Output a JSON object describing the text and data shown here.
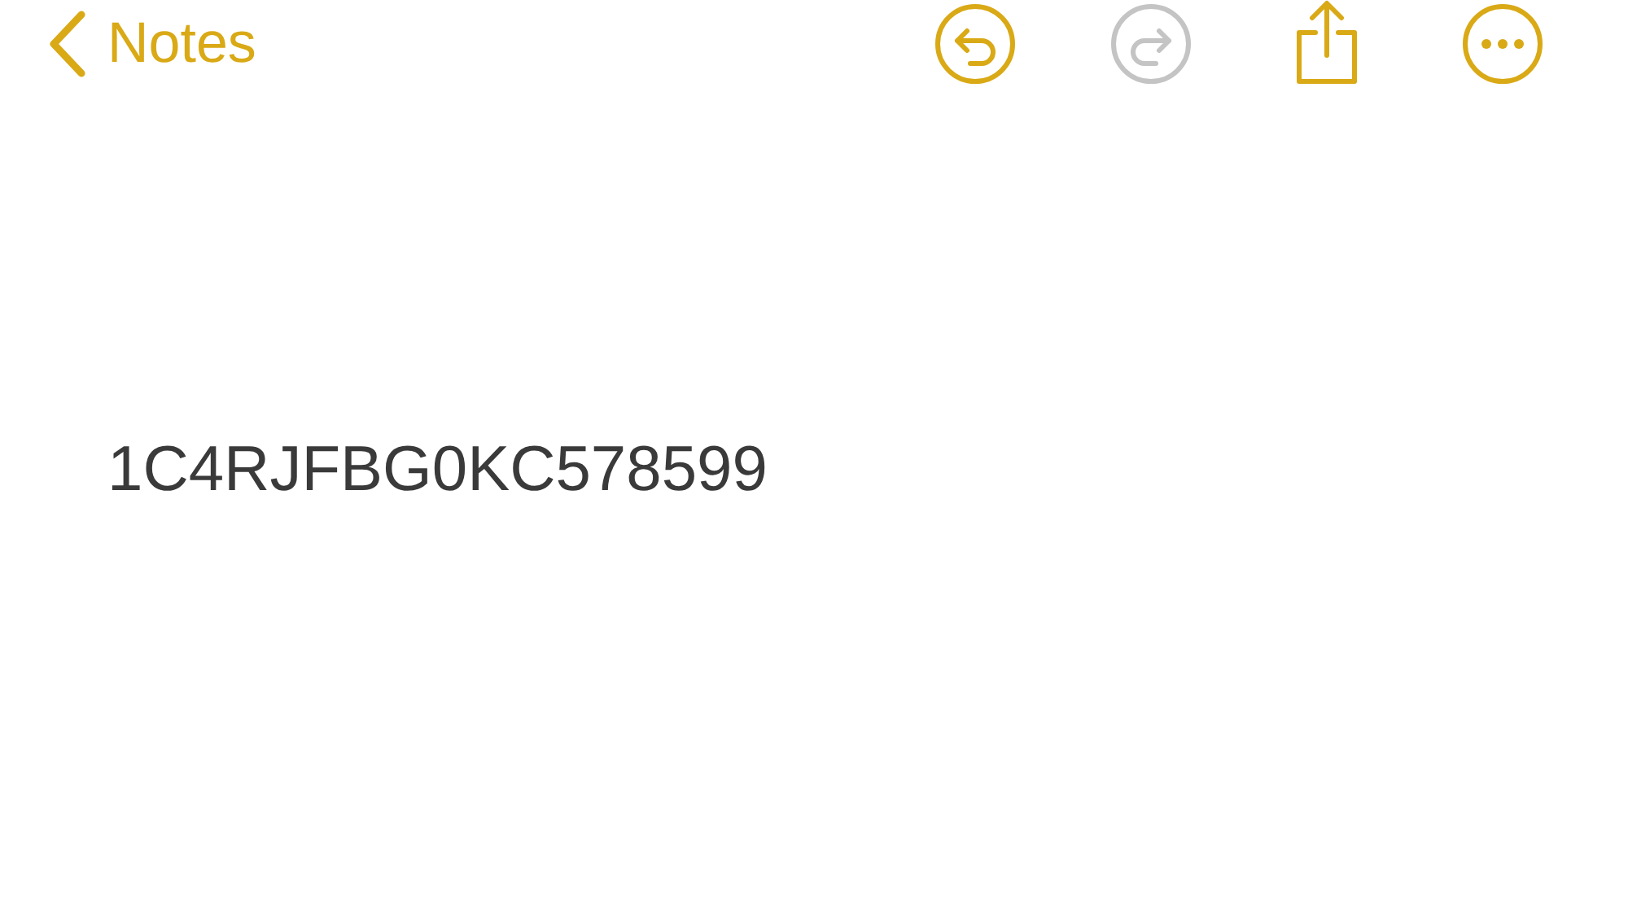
{
  "nav": {
    "back_label": "Notes"
  },
  "toolbar": [
    {
      "kind": "undo",
      "disabled": false
    },
    {
      "kind": "redo",
      "disabled": true
    },
    {
      "kind": "share",
      "disabled": false
    },
    {
      "kind": "more",
      "disabled": false
    }
  ],
  "note": {
    "body": "1C4RJFBG0KC578599"
  }
}
